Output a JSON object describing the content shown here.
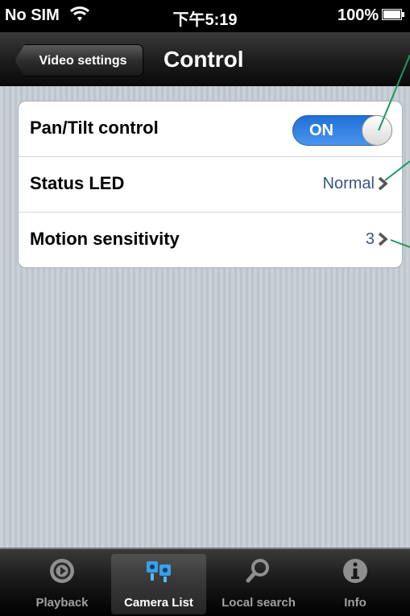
{
  "status_bar": {
    "carrier": "No SIM",
    "time": "下午5:19",
    "battery": "100%"
  },
  "nav": {
    "back_label": "Video settings",
    "title": "Control"
  },
  "settings": {
    "pan_tilt": {
      "label": "Pan/Tilt control",
      "toggle_text": "ON",
      "enabled": true
    },
    "status_led": {
      "label": "Status LED",
      "value": "Normal"
    },
    "motion": {
      "label": "Motion sensitivity",
      "value": "3"
    }
  },
  "tabs": [
    {
      "label": "Playback",
      "icon": "playback-icon",
      "selected": false
    },
    {
      "label": "Camera List",
      "icon": "camera-list-icon",
      "selected": true
    },
    {
      "label": "Local search",
      "icon": "search-icon",
      "selected": false
    },
    {
      "label": "Info",
      "icon": "info-icon",
      "selected": false
    }
  ],
  "colors": {
    "toggle_on": "#2f7fe3",
    "value_text": "#385487",
    "annotation_line": "#1a9a5a"
  }
}
